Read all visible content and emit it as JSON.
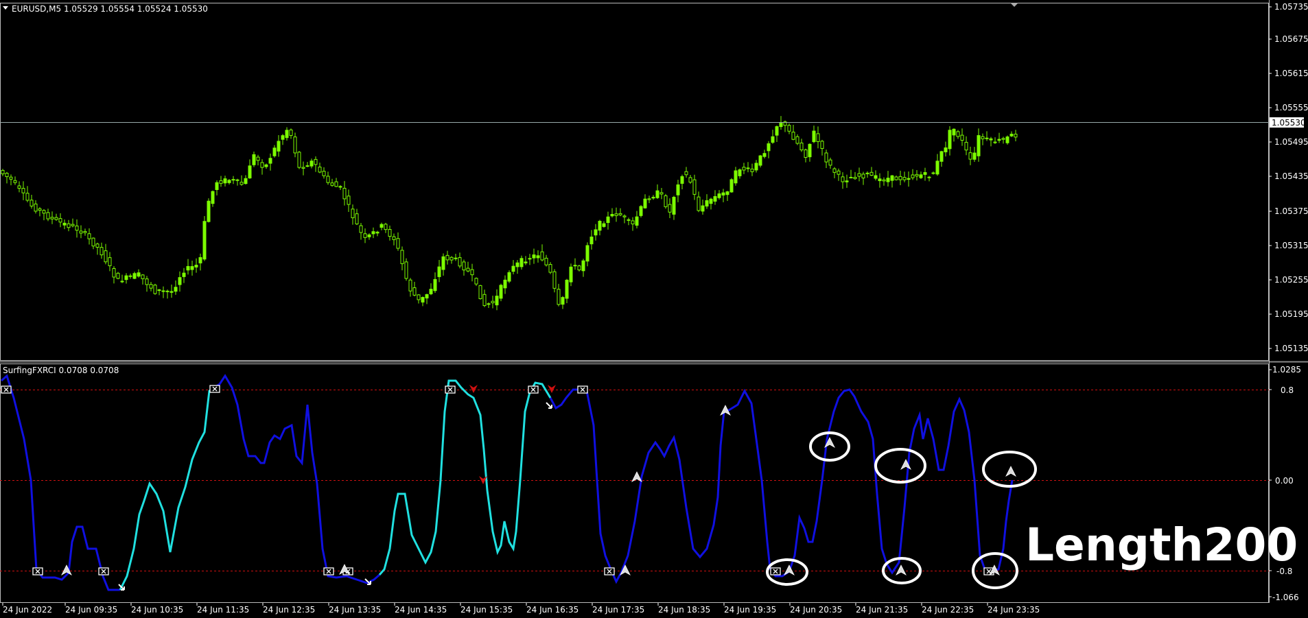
{
  "main_pane": {
    "header": "EURUSD,M5  1.05529 1.05554 1.05524 1.05530",
    "price_scale": [
      "1.05735",
      "1.05675",
      "1.05615",
      "1.05555",
      "1.05495",
      "1.05435",
      "1.05375",
      "1.05315",
      "1.05255",
      "1.05195",
      "1.05135"
    ],
    "current_price": "1.05530",
    "candle_color": "#7CFC00"
  },
  "indicator_pane": {
    "header": "SurfingFXRCI 0.0708 0.0708",
    "scale": [
      "1.0285",
      "0.8",
      "0.00",
      "-0.8",
      "-1.066"
    ],
    "line_color_1": "#1010E0",
    "line_color_2": "#20E0E0",
    "level_color": "#D01010",
    "overlay_text": "Length200"
  },
  "time_axis": [
    "24 Jun 2022",
    "24 Jun 09:35",
    "24 Jun 10:35",
    "24 Jun 11:35",
    "24 Jun 12:35",
    "24 Jun 13:35",
    "24 Jun 14:35",
    "24 Jun 15:35",
    "24 Jun 16:35",
    "24 Jun 17:35",
    "24 Jun 18:35",
    "24 Jun 19:35",
    "24 Jun 20:35",
    "24 Jun 21:35",
    "24 Jun 22:35",
    "24 Jun 23:35"
  ],
  "chart_data": {
    "type": "line",
    "series": [],
    "candle_count": 247,
    "price_range": [
      1.051,
      1.0576
    ],
    "indicator_range": [
      -1.066,
      1.0285
    ],
    "indicator_levels": [
      0.8,
      0.0,
      -0.8
    ]
  }
}
